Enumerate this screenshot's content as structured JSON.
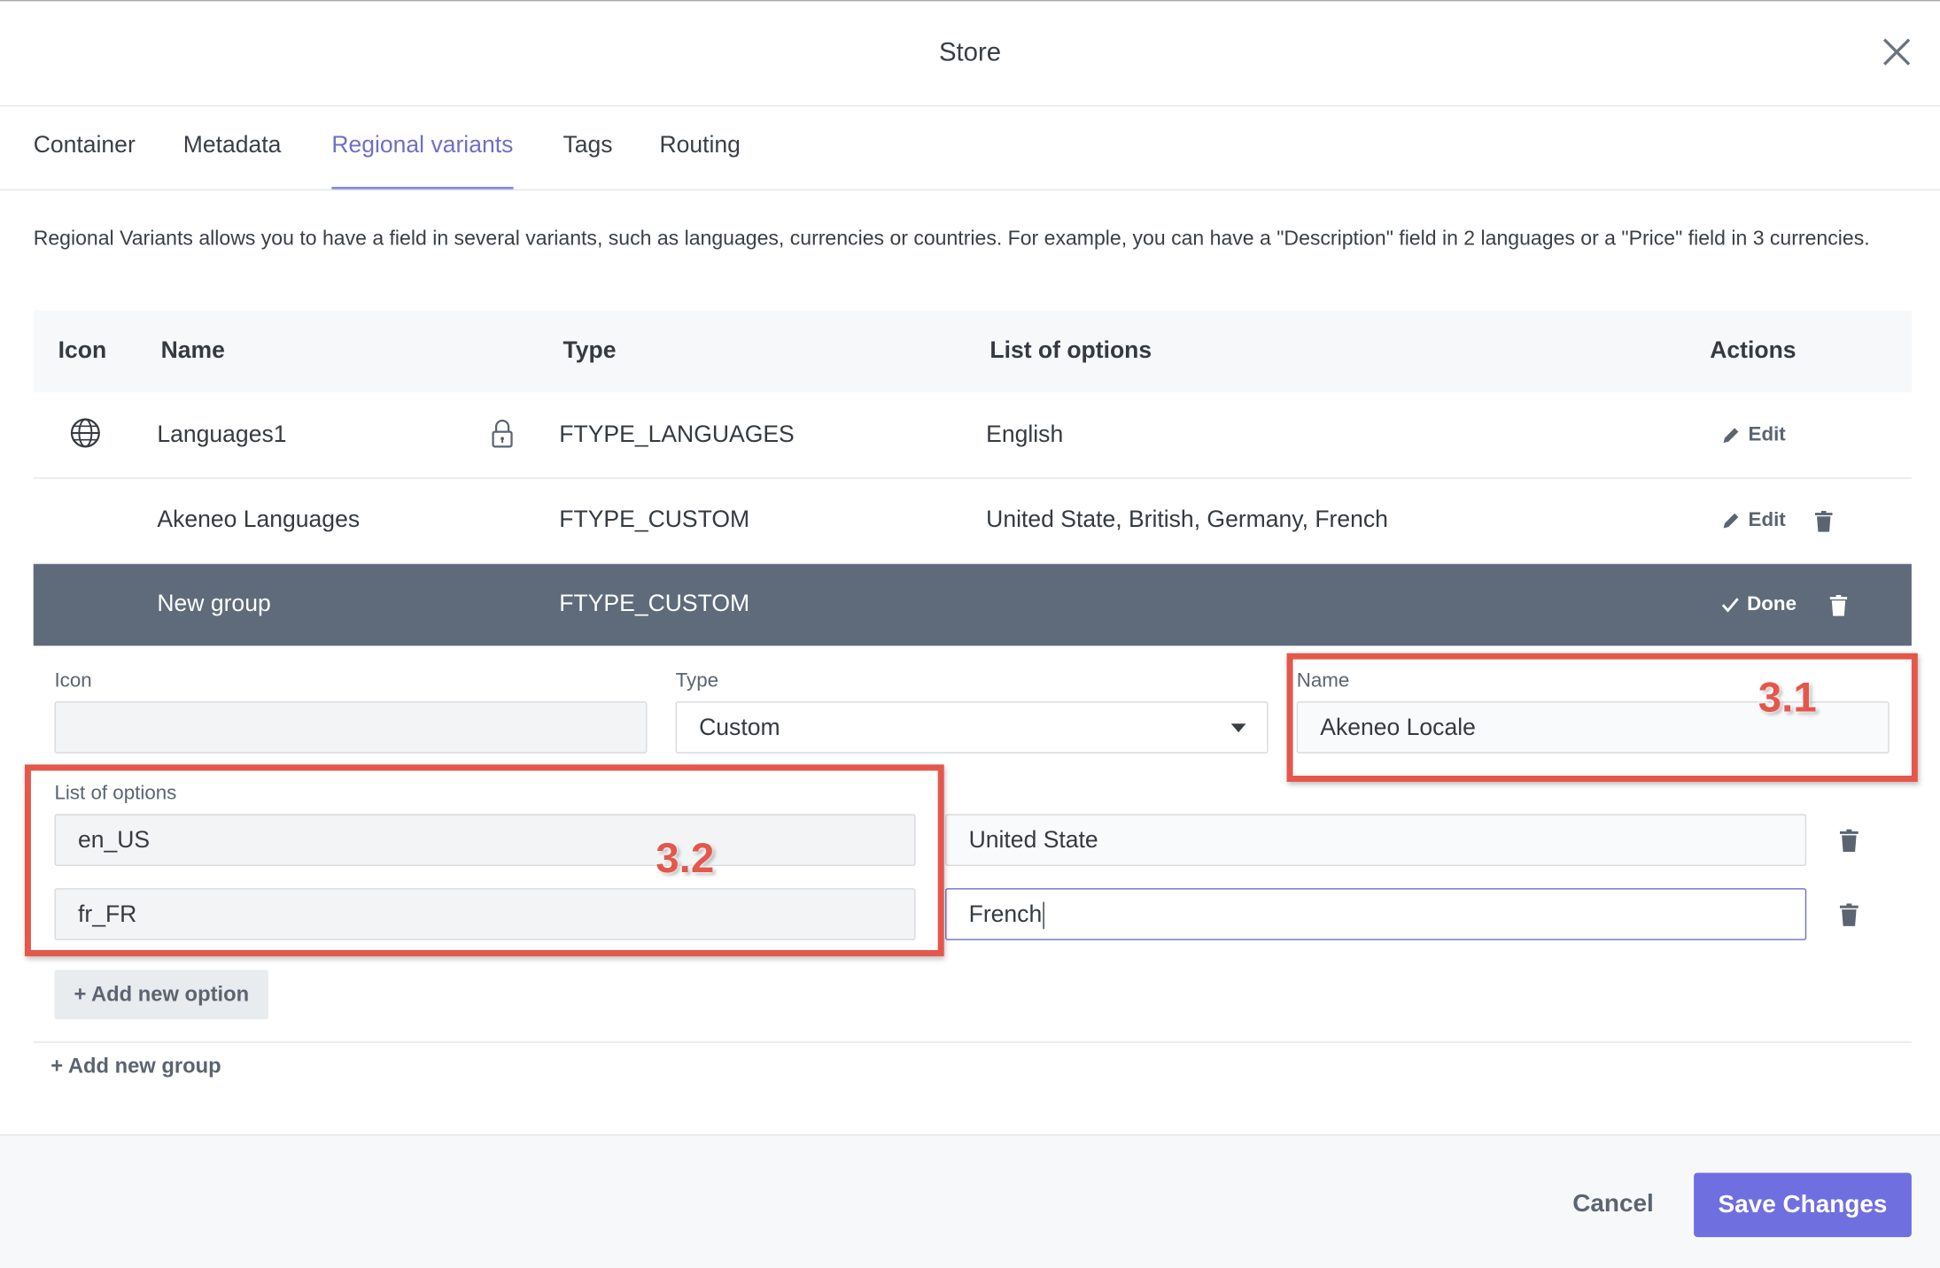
{
  "dialog": {
    "title": "Store"
  },
  "tabs": [
    {
      "label": "Container"
    },
    {
      "label": "Metadata"
    },
    {
      "label": "Regional variants"
    },
    {
      "label": "Tags"
    },
    {
      "label": "Routing"
    }
  ],
  "active_tab": "Regional variants",
  "description": "Regional Variants allows you to have a field in several variants, such as languages, currencies or countries. For example, you can have a \"Description\" field in 2 languages or a \"Price\" field in 3 currencies.",
  "table": {
    "headers": {
      "icon": "Icon",
      "name": "Name",
      "type": "Type",
      "options": "List of options",
      "actions": "Actions"
    },
    "rows": [
      {
        "icon": "globe-icon",
        "name": "Languages1",
        "locked": true,
        "type": "FTYPE_LANGUAGES",
        "options": "English",
        "action": "Edit"
      },
      {
        "name": "Akeneo Languages",
        "type": "FTYPE_CUSTOM",
        "options": "United State, British, Germany, French",
        "action": "Edit"
      },
      {
        "name": "New group",
        "type": "FTYPE_CUSTOM",
        "options": "",
        "action": "Done"
      }
    ]
  },
  "edit_form": {
    "icon_label": "Icon",
    "icon_value": "",
    "type_label": "Type",
    "type_value": "Custom",
    "name_label": "Name",
    "name_value": "Akeneo Locale",
    "options_label": "List of options",
    "options": [
      {
        "key": "en_US",
        "value": "United State"
      },
      {
        "key": "fr_FR",
        "value": "French"
      }
    ],
    "add_option_label": "+ Add new option"
  },
  "add_group_label": "+ Add new group",
  "footer": {
    "cancel_label": "Cancel",
    "save_label": "Save Changes"
  },
  "annotations": [
    {
      "label": "3.1"
    },
    {
      "label": "3.2"
    }
  ],
  "colors": {
    "accent": "#6f6fdf",
    "selected_row": "#5f6b7b",
    "annotation": "#e5574b"
  }
}
